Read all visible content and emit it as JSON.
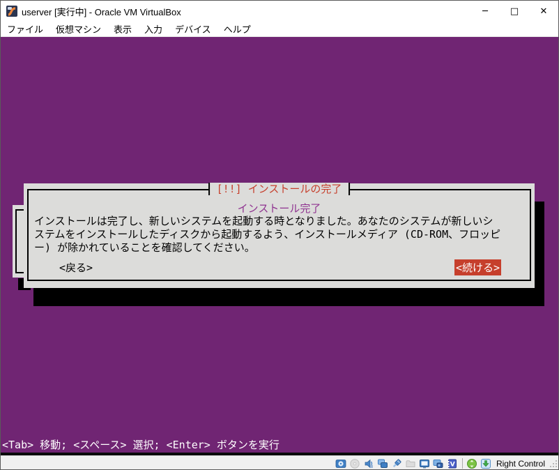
{
  "window": {
    "title": "userver [実行中] - Oracle VM VirtualBox",
    "controls": {
      "minimize": "─",
      "maximize": "□",
      "close": "✕"
    }
  },
  "menubar": {
    "items": [
      {
        "label": "ファイル"
      },
      {
        "label": "仮想マシン"
      },
      {
        "label": "表示"
      },
      {
        "label": "入力"
      },
      {
        "label": "デバイス"
      },
      {
        "label": "ヘルプ"
      }
    ]
  },
  "installer": {
    "dialog": {
      "title": "[!!] インストールの完了",
      "heading": "インストール完了",
      "body_lines": [
        "インストールは完了し、新しいシステムを起動する時となりました。あなたのシステムが新しいシ",
        "ステムをインストールしたディスクから起動するよう、インストールメディア (CD-ROM、フロッピ",
        "ー) が除かれていることを確認してください。"
      ],
      "back_button": "<戻る>",
      "continue_button": "<続ける>"
    },
    "help_line": "<Tab> 移動; <スペース> 選択; <Enter> ボタンを実行"
  },
  "statusbar": {
    "icons": [
      "hard-disks-icon",
      "optical-drives-icon",
      "audio-icon",
      "network-icon",
      "usb-icon",
      "shared-folders-icon",
      "display-icon",
      "recording-icon",
      "features-icon",
      "mouse-integration-icon",
      "keyboard-capture-icon"
    ],
    "host_key": "Right Control"
  },
  "colors": {
    "console_background": "#702573",
    "dialog_background": "#dcdcda",
    "alert_red": "#c63f2c",
    "heading_purple": "#8f3390",
    "shadow_black": "#000000"
  }
}
